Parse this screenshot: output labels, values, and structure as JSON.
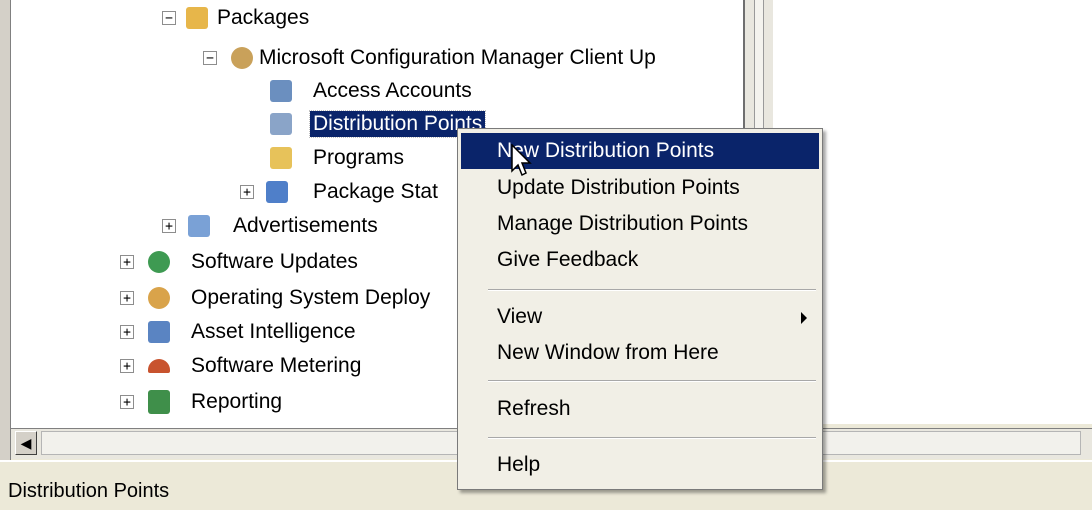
{
  "tree": {
    "items": [
      {
        "label": "Packages",
        "expander": "−",
        "icon_color": "#e7b64a",
        "icon_name": "packages-folder-icon"
      },
      {
        "label": "Microsoft Configuration Manager Client Up",
        "expander": "−",
        "icon_color": "#c9a15a",
        "icon_name": "package-icon"
      },
      {
        "label": "Access Accounts",
        "expander": "",
        "icon_color": "#6b8fbf",
        "icon_name": "access-accounts-icon"
      },
      {
        "label": "Distribution Points",
        "expander": "",
        "icon_color": "#8aa4c8",
        "icon_name": "distribution-points-icon"
      },
      {
        "label": "Programs",
        "expander": "",
        "icon_color": "#e7c25a",
        "icon_name": "programs-folder-icon"
      },
      {
        "label": "Package Stat",
        "expander": "+",
        "icon_color": "#4f7fc9",
        "icon_name": "package-status-icon"
      },
      {
        "label": "Advertisements",
        "expander": "+",
        "icon_color": "#7aa1d6",
        "icon_name": "advertisements-icon"
      },
      {
        "label": "Software Updates",
        "expander": "+",
        "icon_color": "#3e9a52",
        "icon_name": "software-updates-icon"
      },
      {
        "label": "Operating System Deploy",
        "expander": "+",
        "icon_color": "#d9a34a",
        "icon_name": "os-deployment-icon"
      },
      {
        "label": "Asset Intelligence",
        "expander": "+",
        "icon_color": "#5a84c2",
        "icon_name": "asset-intelligence-icon"
      },
      {
        "label": "Software Metering",
        "expander": "+",
        "icon_color": "#c8532e",
        "icon_name": "software-metering-icon"
      },
      {
        "label": "Reporting",
        "expander": "+",
        "icon_color": "#3f8f4a",
        "icon_name": "reporting-icon"
      }
    ]
  },
  "context_menu": {
    "items": [
      {
        "label": "New Distribution Points",
        "highlighted": true
      },
      {
        "label": "Update Distribution Points"
      },
      {
        "label": "Manage Distribution Points"
      },
      {
        "label": "Give Feedback"
      },
      {
        "label": "View",
        "submenu": true
      },
      {
        "label": "New Window from Here"
      },
      {
        "label": "Refresh"
      },
      {
        "label": "Help"
      }
    ]
  },
  "status_bar": {
    "text": "Distribution Points"
  },
  "colors": {
    "selection": "#0a246a",
    "menu_bg": "#f1efe6",
    "window_bg": "#ece9d8"
  }
}
